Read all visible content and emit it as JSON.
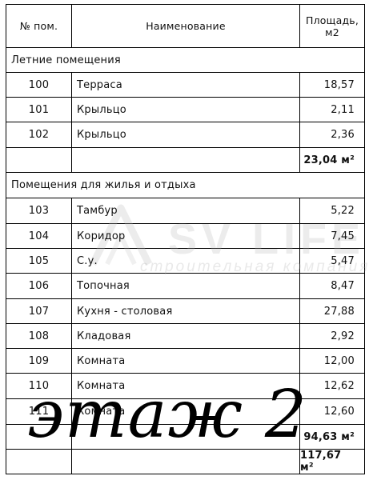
{
  "table": {
    "header": {
      "num": "№ пом.",
      "name": "Наименование",
      "area_line1": "Площадь,",
      "area_line2": "м2"
    },
    "sections": [
      {
        "title": "Летние помещения",
        "rows": [
          {
            "num": "100",
            "name": "Терраса",
            "area": "18,57"
          },
          {
            "num": "101",
            "name": "Крыльцо",
            "area": "2,11"
          },
          {
            "num": "102",
            "name": "Крыльцо",
            "area": "2,36"
          }
        ],
        "subtotal": "23,04 м²"
      },
      {
        "title": "Помещения для жилья и отдыха",
        "rows": [
          {
            "num": "103",
            "name": "Тамбур",
            "area": "5,22"
          },
          {
            "num": "104",
            "name": "Коридор",
            "area": "7,45"
          },
          {
            "num": "105",
            "name": "С.у.",
            "area": "5,47"
          },
          {
            "num": "106",
            "name": "Топочная",
            "area": "8,47"
          },
          {
            "num": "107",
            "name": "Кухня - столовая",
            "area": "27,88"
          },
          {
            "num": "108",
            "name": "Кладовая",
            "area": "2,92"
          },
          {
            "num": "109",
            "name": "Комната",
            "area": "12,00"
          },
          {
            "num": "110",
            "name": "Комната",
            "area": "12,62"
          },
          {
            "num": "111",
            "name": "Комната",
            "area": "12,60"
          }
        ],
        "subtotal": "94,63 м²"
      }
    ],
    "total": "117,67 м²"
  },
  "watermark": {
    "logo": "SV LIFE",
    "tagline": "строительная компания"
  },
  "overlay": {
    "floor_label": "этаж 2"
  }
}
